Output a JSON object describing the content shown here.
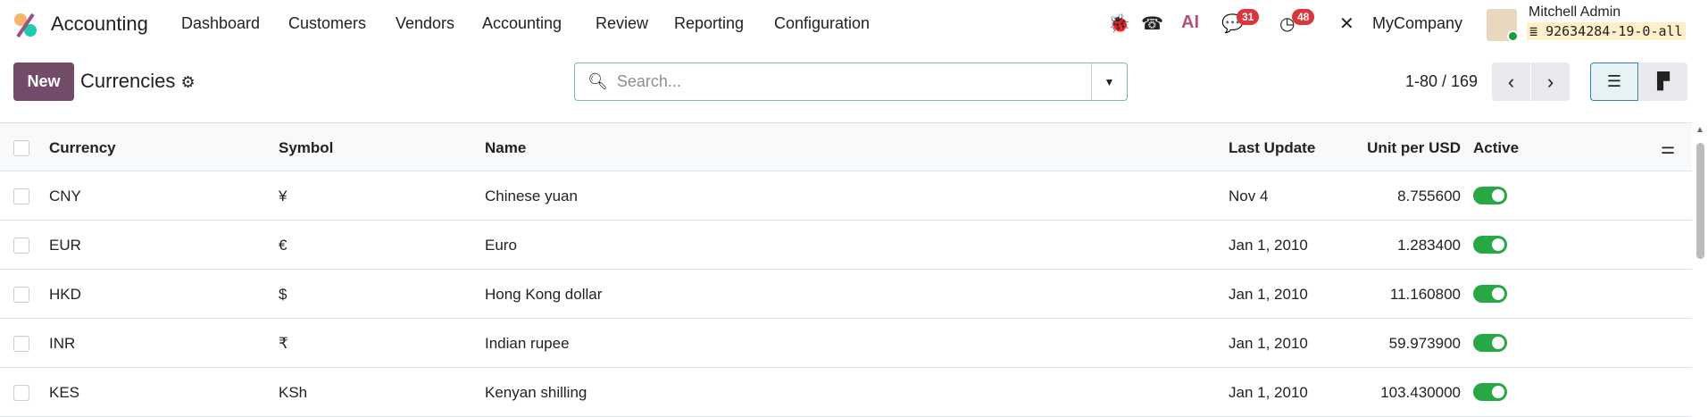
{
  "navbar": {
    "app_name": "Accounting",
    "menu": [
      "Dashboard",
      "Customers",
      "Vendors",
      "Accounting",
      "Review",
      "Reporting",
      "Configuration"
    ],
    "messages_count": "31",
    "activities_count": "48",
    "ai_label": "AI",
    "company": "MyCompany",
    "user_name": "Mitchell Admin",
    "database": "92634284-19-0-all"
  },
  "control": {
    "new_label": "New",
    "title": "Currencies",
    "search_placeholder": "Search...",
    "pager": "1-80 / 169"
  },
  "table": {
    "headers": {
      "currency": "Currency",
      "symbol": "Symbol",
      "name": "Name",
      "last_update": "Last Update",
      "rate": "Unit per USD",
      "active": "Active"
    },
    "rows": [
      {
        "currency": "CNY",
        "symbol": "¥",
        "name": "Chinese yuan",
        "last_update": "Nov 4",
        "rate": "8.755600",
        "active": true
      },
      {
        "currency": "EUR",
        "symbol": "€",
        "name": "Euro",
        "last_update": "Jan 1, 2010",
        "rate": "1.283400",
        "active": true
      },
      {
        "currency": "HKD",
        "symbol": "$",
        "name": "Hong Kong dollar",
        "last_update": "Jan 1, 2010",
        "rate": "11.160800",
        "active": true
      },
      {
        "currency": "INR",
        "symbol": "₹",
        "name": "Indian rupee",
        "last_update": "Jan 1, 2010",
        "rate": "59.973900",
        "active": true
      },
      {
        "currency": "KES",
        "symbol": "KSh",
        "name": "Kenyan shilling",
        "last_update": "Jan 1, 2010",
        "rate": "103.430000",
        "active": true
      }
    ]
  },
  "colors": {
    "brand": "#714b67",
    "toggle_on": "#28a745",
    "badge": "#d9363e"
  }
}
